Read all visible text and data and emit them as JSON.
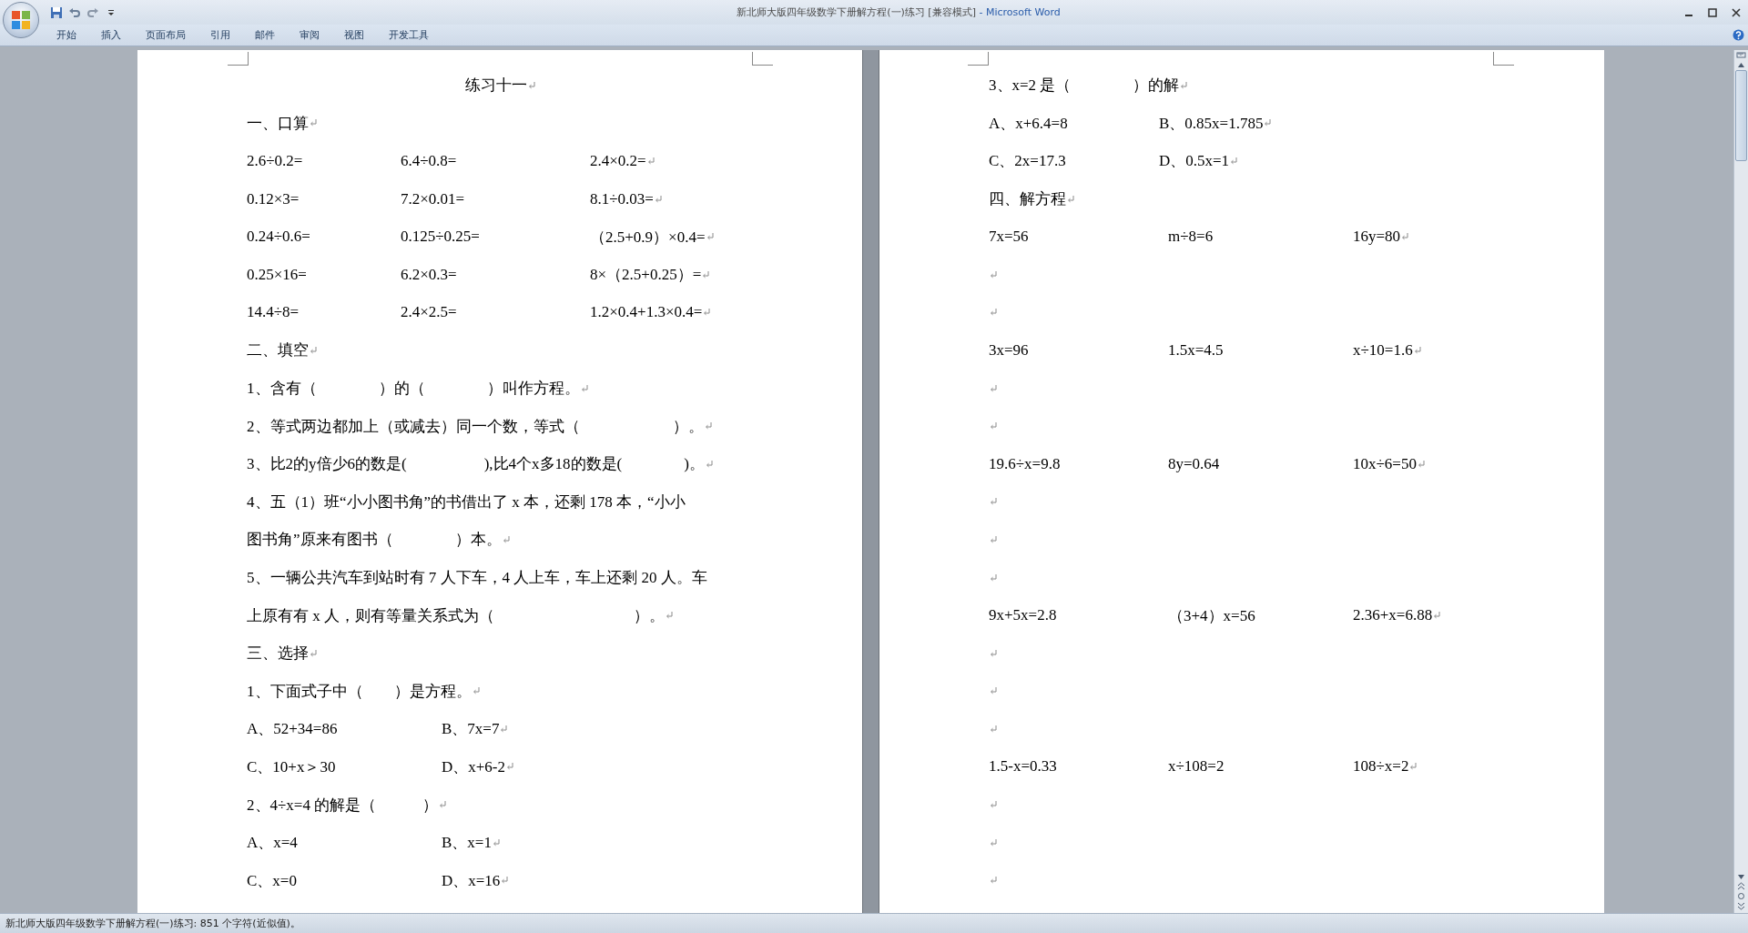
{
  "window": {
    "title": "新北师大版四年级数学下册解方程(一)练习 [兼容模式]",
    "app_name": "- Microsoft Word"
  },
  "ribbon_tabs": [
    {
      "label": "开始",
      "selected": false
    },
    {
      "label": "插入",
      "selected": false
    },
    {
      "label": "页面布局",
      "selected": false
    },
    {
      "label": "引用",
      "selected": false
    },
    {
      "label": "邮件",
      "selected": false
    },
    {
      "label": "审阅",
      "selected": false
    },
    {
      "label": "视图",
      "selected": false
    },
    {
      "label": "开发工具",
      "selected": false
    }
  ],
  "pages": [
    {
      "paragraphs": [
        {
          "kind": "title",
          "text": "练习十一"
        },
        {
          "kind": "heading",
          "text": "一、口算"
        },
        {
          "kind": "calc_row",
          "cells": [
            "2.6÷0.2=",
            "6.4÷0.8=",
            "2.4×0.2="
          ]
        },
        {
          "kind": "calc_row",
          "cells": [
            "0.12×3=",
            "7.2×0.01=",
            "8.1÷0.03="
          ]
        },
        {
          "kind": "calc_row",
          "cells": [
            "0.24÷0.6=",
            "0.125÷0.25=",
            "（2.5+0.9）×0.4="
          ]
        },
        {
          "kind": "calc_row",
          "cells": [
            "0.25×16=",
            "6.2×0.3=",
            "8×（2.5+0.25）="
          ]
        },
        {
          "kind": "calc_row",
          "cells": [
            "14.4÷8=",
            "2.4×2.5=",
            "1.2×0.4+1.3×0.4="
          ]
        },
        {
          "kind": "heading",
          "text": "二、填空"
        },
        {
          "kind": "text",
          "text": "1、含有（　　　　）的（　　　　）叫作方程。"
        },
        {
          "kind": "text",
          "text": "2、等式两边都加上（或减去）同一个数，等式（　　　　　　）。"
        },
        {
          "kind": "text",
          "text": "3、比2的y倍少6的数是(　　　　　),比4个x多18的数是(　　　　)。"
        },
        {
          "kind": "wrapped",
          "lines": [
            "4、五（1）班“小小图书角”的书借出了 x 本，还剩 178 本，“小小",
            "图书角”原来有图书（　　　　）本。"
          ]
        },
        {
          "kind": "wrapped",
          "lines": [
            "5、一辆公共汽车到站时有 7 人下车，4 人上车，车上还剩 20 人。车",
            "上原有有 x 人，则有等量关系式为（　　　　　　　　　）。"
          ]
        },
        {
          "kind": "heading",
          "text": "三、选择"
        },
        {
          "kind": "text",
          "text": "1、下面式子中（　　）是方程。"
        },
        {
          "kind": "option_row",
          "cells": [
            "A、52+34=86",
            "B、7x=7"
          ]
        },
        {
          "kind": "option_row",
          "cells": [
            "C、10+x＞30",
            "D、x+6-2"
          ]
        },
        {
          "kind": "text",
          "text": "2、4÷x=4 的解是（　　　）"
        },
        {
          "kind": "option_row",
          "cells": [
            "A、x=4",
            "B、x=1"
          ]
        },
        {
          "kind": "option_row",
          "cells": [
            "C、x=0",
            "D、x=16"
          ]
        }
      ]
    },
    {
      "paragraphs": [
        {
          "kind": "text",
          "text": "3、x=2 是（　　　　）的解"
        },
        {
          "kind": "option_row",
          "cells": [
            "A、x+6.4=8",
            "B、0.85x=1.785"
          ]
        },
        {
          "kind": "option_row",
          "cells": [
            "C、2x=17.3",
            "D、0.5x=1"
          ]
        },
        {
          "kind": "heading",
          "text": "四、解方程"
        },
        {
          "kind": "equation_row",
          "cells": [
            "7x=56",
            "m÷8=6",
            "16y=80"
          ]
        },
        {
          "kind": "blank"
        },
        {
          "kind": "blank"
        },
        {
          "kind": "equation_row",
          "cells": [
            "3x=96",
            "1.5x=4.5",
            "x÷10=1.6"
          ]
        },
        {
          "kind": "blank"
        },
        {
          "kind": "blank"
        },
        {
          "kind": "equation_row",
          "cells": [
            "19.6÷x=9.8",
            "8y=0.64",
            "10x÷6=50"
          ]
        },
        {
          "kind": "blank"
        },
        {
          "kind": "blank"
        },
        {
          "kind": "blank"
        },
        {
          "kind": "equation_row",
          "cells": [
            "9x+5x=2.8",
            "（3+4）x=56",
            "2.36+x=6.88"
          ]
        },
        {
          "kind": "blank"
        },
        {
          "kind": "blank"
        },
        {
          "kind": "blank"
        },
        {
          "kind": "equation_row",
          "cells": [
            "1.5-x=0.33",
            "x÷108=2",
            "108÷x=2"
          ]
        },
        {
          "kind": "blank"
        },
        {
          "kind": "blank"
        },
        {
          "kind": "blank"
        }
      ]
    }
  ],
  "status_bar": {
    "text": "新北师大版四年级数学下册解方程(一)练习: 851 个字符(近似值)。"
  }
}
